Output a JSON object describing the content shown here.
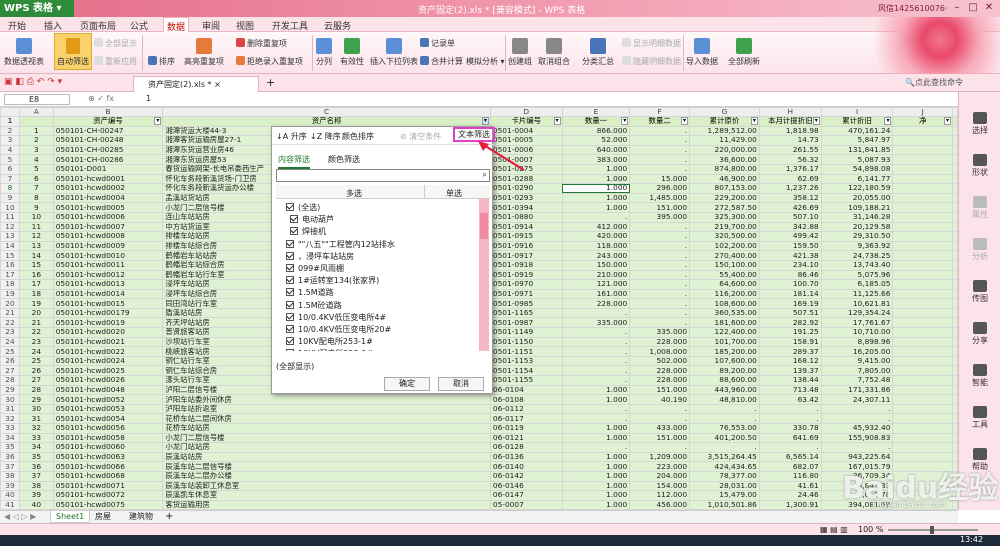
{
  "titlebar": {
    "app": "WPS 表格",
    "title": "资产固定(2).xls * [兼容模式] - WPS 表格",
    "user": "风信1425610076·",
    "time": "13:42"
  },
  "menu": [
    "开始",
    "插入",
    "页面布局",
    "公式",
    "数据",
    "审阅",
    "视图",
    "开发工具",
    "云服务"
  ],
  "menu_active": "数据",
  "ribbon": {
    "pivot": "数据透视表",
    "autofilter": "自动筛选",
    "show_all": "全部显示",
    "reapply": "重新应用",
    "sort": "排序",
    "adv_filter": "高亮重复项",
    "del_dup": "删除重复项",
    "reject_dup": "拒绝录入重复项",
    "split": "分列",
    "validity": "有效性",
    "insert_dropdown": "插入下拉列表",
    "merge_calc": "合并计算",
    "record": "记录单",
    "what_if": "模拟分析",
    "create_group": "创建组",
    "ungroup": "取消组合",
    "subtotal": "分类汇总",
    "show_detail": "显示明细数据",
    "hide_detail": "隐藏明细数据",
    "import": "导入数据",
    "refresh": "全部刷新"
  },
  "doctabs": {
    "file": "资产固定(2).xls *",
    "find": "点此查找命令"
  },
  "formula": {
    "cell": "E8",
    "value": "1"
  },
  "columns": [
    "A",
    "B",
    "C",
    "D",
    "E",
    "F",
    "G",
    "H",
    "I",
    "J"
  ],
  "header_row": [
    "",
    "资产编号",
    "资产名称",
    "卡片编号",
    "数量一",
    "数量二",
    "累计原价",
    "本月计提折旧",
    "累计折旧",
    "净"
  ],
  "rows": [
    [
      "1",
      "050101-CH-00247",
      "湘潭货运大楼44-3",
      "0501-0004",
      "866.000",
      ".",
      "1,289,512.00",
      "1,818.98",
      "470,161.24"
    ],
    [
      "2",
      "050101-CH-00248",
      "湘潭客货运输房屋27-1",
      "0501-0005",
      "52.000",
      ".",
      "11,429.00",
      "14.73",
      "5,847.97"
    ],
    [
      "3",
      "050101-CH-00285",
      "湘潭东货运营业房46",
      "0501-0006",
      "640.000",
      ".",
      "220,000.00",
      "261.55",
      "131,841.85"
    ],
    [
      "4",
      "050101-CH-00286",
      "湘潭东货运房屋53",
      "0501-0007",
      "383.000",
      ".",
      "36,600.00",
      "56.32",
      "5,087.93"
    ],
    [
      "5",
      "050101-D001",
      "春货运输网架-长电吊委西生产",
      "0501-0275",
      "1.000",
      ".",
      "874,800.00",
      "1,376.17",
      "54,898.08"
    ],
    [
      "6",
      "050101-hcwd0001",
      "怀化车务段新溪货场-门卫房",
      "0501-0288",
      "1.000",
      "15.000",
      "46,900.00",
      "62.69",
      "6,141.77"
    ],
    [
      "7",
      "050101-hcwd0002",
      "怀化车务段新溪货运办公楼",
      "0501-0290",
      "1.000",
      "296.000",
      "807,153.00",
      "1,237.26",
      "122,180.59"
    ],
    [
      "8",
      "050101-hcwd0004",
      "孟溪站货站房",
      "0501-0293",
      "1.000",
      "1,485.000",
      "229,200.00",
      "358.12",
      "20,055.00"
    ],
    [
      "9",
      "050101-hcwd0005",
      "小龙门二层信号楼",
      "0501-0394",
      "1.000",
      "151.000",
      "272,587.50",
      "426.69",
      "109,188.21"
    ],
    [
      "10",
      "050101-hcwd0006",
      "连山车站站房",
      "0501-0880",
      ".",
      "395.000",
      "325,300.00",
      "507.10",
      "31,146.28"
    ],
    [
      "11",
      "050101-hcwd0007",
      "中方站货运室",
      "0501-0914",
      "412.000",
      ".",
      "219,700.00",
      "342.88",
      "20,129.58"
    ],
    [
      "12",
      "050101-hcwd0008",
      "排楼车站站房",
      "0501-0915",
      "420.000",
      ".",
      "320,500.00",
      "499.42",
      "29,310.50"
    ],
    [
      "13",
      "050101-hcwd0009",
      "排楼车站综合房",
      "0501-0916",
      "118.000",
      ".",
      "102,200.00",
      "159.50",
      "9,363.92"
    ],
    [
      "14",
      "050101-hcwd0010",
      "鹤幡岩车站站房",
      "0501-0917",
      "243.000",
      ".",
      "270,400.00",
      "421.38",
      "24,738.25"
    ],
    [
      "15",
      "050101-hcwd0011",
      "鹤幡岩车站综合房",
      "0501-0918",
      "150.000",
      ".",
      "150,100.00",
      "234.10",
      "13,743.40"
    ],
    [
      "16",
      "050101-hcwd0012",
      "鹤幡岩车站行车室",
      "0501-0919",
      "210.000",
      ".",
      "55,400.00",
      "86.46",
      "5,075.96"
    ],
    [
      "17",
      "050101-hcwd0013",
      "浸坪车站站房",
      "0501-0970",
      "121.000",
      ".",
      "64,600.00",
      "100.70",
      "6,185.05"
    ],
    [
      "18",
      "050101-hcwd0014",
      "浸坪车站综合房",
      "0501-0971",
      "161.000",
      ".",
      "116,200.00",
      "181.14",
      "11,125.66"
    ],
    [
      "19",
      "050101-hcwd0015",
      "同田湾站行车室",
      "0501-0985",
      "228.000",
      ".",
      "108,600.00",
      "169.19",
      "10,621.81"
    ],
    [
      "20",
      "050101-hcwd00179",
      "盾溪站站房",
      "0501-1165",
      ".",
      ".",
      "360,535.00",
      "507.51",
      "129,354.24"
    ],
    [
      "21",
      "050101-hcwd0019",
      "齐天坪站站房",
      "0501-0987",
      "335.000",
      ".",
      "181,600.00",
      "282.92",
      "17,761.67"
    ],
    [
      "22",
      "050101-hcwd0020",
      "普贤旅客站房",
      "0501-1149",
      ".",
      "335.000",
      "122,400.00",
      "191.25",
      "10,710.00"
    ],
    [
      "23",
      "050101-hcwd0021",
      "沙坝站行车室",
      "0501-1150",
      ".",
      "228.000",
      "101,700.00",
      "158.91",
      "8,898.96"
    ],
    [
      "24",
      "050101-hcwd0022",
      "桃峡旅客站房",
      "0501-1151",
      ".",
      "1,008.000",
      "185,200.00",
      "289.37",
      "16,205.00"
    ],
    [
      "25",
      "050101-hcwd0024",
      "铜仁站行车室",
      "0501-1153",
      ".",
      "502.000",
      "107,600.00",
      "168.12",
      "9,415.00"
    ],
    [
      "26",
      "050101-hcwd0025",
      "铜仁车站综合房",
      "0501-1154",
      ".",
      "228.000",
      "89,200.00",
      "139.37",
      "7,805.00"
    ],
    [
      "27",
      "050101-hcwd0026",
      "漾头站行车室",
      "0501-1155",
      ".",
      "228.000",
      "88,600.00",
      "138.44",
      "7,752.48"
    ],
    [
      "28",
      "050101-hcwd0048",
      "泸阳二层信号楼",
      "06-0104",
      "1.000",
      "151.000",
      "443,960.00",
      "713.48",
      "171,331.86"
    ],
    [
      "29",
      "050101-hcwd0052",
      "泸阳车站委外间休房",
      "06-0108",
      "1.000",
      "40.190",
      "48,810.00",
      "63.42",
      "24,307.11"
    ],
    [
      "30",
      "050101-hcwd0053",
      "泸阳车站折返室",
      "06-0112",
      ".",
      ".",
      ".",
      ".",
      "."
    ],
    [
      "31",
      "050101-hcwd0054",
      "花桥车站二层间休房",
      "06-0117",
      ".",
      ".",
      ".",
      ".",
      "."
    ],
    [
      "32",
      "050101-hcwd0056",
      "花桥车站站房",
      "06-0119",
      "1.000",
      "433.000",
      "76,553.00",
      "330.78",
      "45,932.40"
    ],
    [
      "33",
      "050101-hcwd0058",
      "小龙门二层信号楼",
      "06-0121",
      "1.000",
      "151.000",
      "401,200.50",
      "641.69",
      "155,908.83"
    ],
    [
      "34",
      "050101-hcwd0060",
      "小龙门站站房",
      "06-0128",
      ".",
      ".",
      ".",
      ".",
      "."
    ],
    [
      "35",
      "050101-hcwd0063",
      "辰溪站站房",
      "06-0136",
      "1.000",
      "1,209.000",
      "3,515,264.45",
      "6,565.14",
      "943,225.64"
    ],
    [
      "36",
      "050101-hcwd0066",
      "辰溪车站二层信号楼",
      "06-0140",
      "1.000",
      "223.000",
      "424,434.65",
      "682.07",
      "167,015.79"
    ],
    [
      "37",
      "050101-hcwd0068",
      "辰溪车站二层办公楼",
      "06-0142",
      "1.000",
      "204.000",
      "78,377.00",
      "116.80",
      "26,709.34"
    ],
    [
      "38",
      "050101-hcwd0071",
      "辰溪车站装卸工休息室",
      "06-0146",
      "1.000",
      "154.000",
      "28,031.00",
      "41.61",
      "8,843.33"
    ],
    [
      "39",
      "050101-hcwd0072",
      "辰溪凯车休息室",
      "06-0147",
      "1.000",
      "112.000",
      "15,479.00",
      "24.46",
      "7,012.78"
    ],
    [
      "40",
      "050101-hcwd0075",
      "客货运输用房",
      "05-0007",
      "1.000",
      "456.000",
      "1,010,501.86",
      "1,300.91",
      "394,081.69"
    ],
    [
      "41",
      "050101-hcwd0077",
      "大江口货运室",
      "06-0161",
      "1.000",
      "229.000",
      "86,210.00",
      "117.20",
      "19,418.16"
    ]
  ],
  "dropdown": {
    "sort_asc": "升序",
    "sort_desc": "降序",
    "color_sort": "颜色排序",
    "clear": "清空条件",
    "text_filter": "文本筛选",
    "tab_content": "内容筛选",
    "tab_color": "颜色筛选",
    "col_multi": "多选",
    "col_single": "单选",
    "items": [
      "(全选)",
      "电动葫芦",
      "焊接机",
      "\"\"八五\"\"工程管内12站排水",
      "，浸坪车站站房",
      "099#风雨棚",
      "1#运转室134(张家界)",
      "1.5M道路",
      "1.5M砼道路",
      "10/0.4KV低压变电所4#",
      "10/0.4KV低压变电所20#",
      "10KV配电所253-1#",
      "10КV配电所253-1#"
    ],
    "show_all": "(全部显示)",
    "ok": "确定",
    "cancel": "取消"
  },
  "rightpane": [
    "选择",
    "形状",
    "属性",
    "分析",
    "传图",
    "分享",
    "智能",
    "工具",
    "帮助"
  ],
  "sheets": [
    "Sheet1",
    "房屋",
    "建筑物"
  ],
  "status": {
    "zoom": "100 %"
  },
  "watermark": {
    "brand": "Baidu经验",
    "url": "jingyan.baidu.com"
  },
  "colors": {
    "accent": "#e56b86",
    "header_green": "#d9f0c7",
    "row_green": "#dff2d3",
    "filter_highlight": "#e040c8",
    "arrow": "#e0203a"
  }
}
